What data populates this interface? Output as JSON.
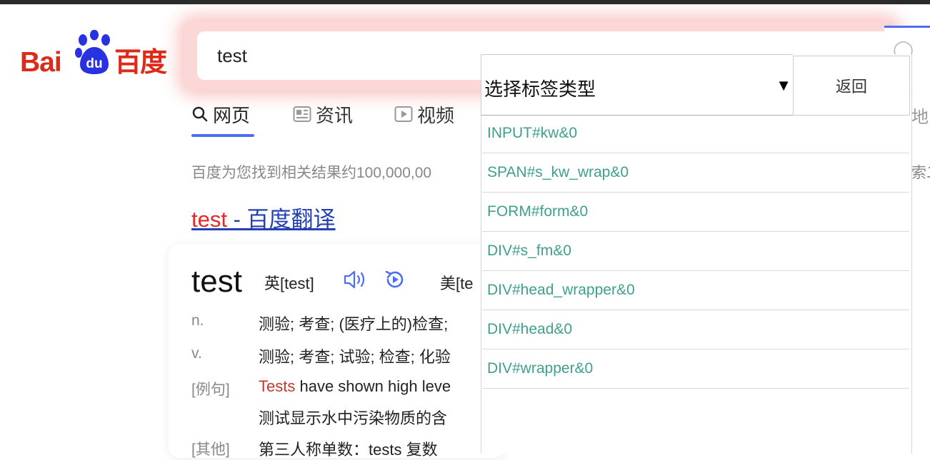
{
  "search": {
    "value": "test"
  },
  "logo": {
    "latin": "Bai",
    "du": "du",
    "chinese": "百度"
  },
  "tabs": [
    {
      "label": "网页",
      "icon": "search-icon"
    },
    {
      "label": "资讯",
      "icon": "news-icon"
    },
    {
      "label": "视频",
      "icon": "video-icon"
    }
  ],
  "results": {
    "count_text": "百度为您找到相关结果约100,000,00",
    "title_prefix": "test",
    "title_suffix": " - 百度翻译"
  },
  "dictionary": {
    "word": "test",
    "uk_phonetic": "英[test]",
    "us_phonetic": "美[te",
    "definitions": [
      {
        "label": "n.",
        "text": "测验; 考查; (医疗上的)检查;"
      },
      {
        "label": "v.",
        "text": "测验; 考查; 试验; 检查; 化验"
      },
      {
        "label": "[例句]",
        "text_highlight": "Tests",
        "text": " have shown high leve"
      },
      {
        "label": "",
        "text": "测试显示水中污染物质的含"
      },
      {
        "label": "[其他]",
        "text": "第三人称单数：tests    复数"
      }
    ]
  },
  "overlay": {
    "select_value": "选择标签类型",
    "select_arrow": "▼",
    "back_label": "返回",
    "items": [
      "INPUT#kw&0",
      "SPAN#s_kw_wrap&0",
      "FORM#form&0",
      "DIV#s_fm&0",
      "DIV#head_wrapper&0",
      "DIV#head&0",
      "DIV#wrapper&0"
    ]
  },
  "right_edge": {
    "tab_fragment": "地",
    "result_fragment": "索二"
  },
  "colors": {
    "baidu_red": "#de2a18",
    "accent_blue": "#4e6ef2",
    "item_teal": "#3fa08c"
  }
}
